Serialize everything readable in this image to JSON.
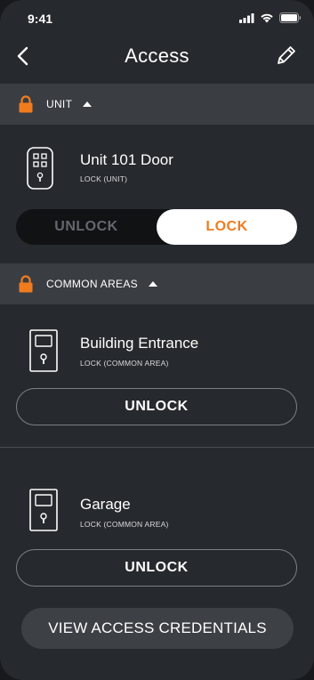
{
  "status_bar": {
    "time": "9:41"
  },
  "header": {
    "title": "Access"
  },
  "sections": [
    {
      "label": "UNIT",
      "doors": [
        {
          "name": "Unit 101 Door",
          "type": "LOCK (UNIT)",
          "unlock_label": "UNLOCK",
          "lock_label": "LOCK",
          "state": "locked"
        }
      ]
    },
    {
      "label": "COMMON AREAS",
      "doors": [
        {
          "name": "Building Entrance",
          "type": "LOCK (COMMON AREA)",
          "action_label": "UNLOCK"
        },
        {
          "name": "Garage",
          "type": "LOCK (COMMON AREA)",
          "action_label": "UNLOCK"
        }
      ]
    }
  ],
  "footer": {
    "credentials_label": "VIEW ACCESS CREDENTIALS"
  },
  "colors": {
    "accent": "#f07c1e",
    "background": "#26292d",
    "section_bg": "#3a3e43"
  },
  "icons": [
    "back-chevron-icon",
    "edit-pencil-icon",
    "padlock-icon",
    "caret-up-icon",
    "keypad-lock-icon",
    "door-lock-icon"
  ]
}
